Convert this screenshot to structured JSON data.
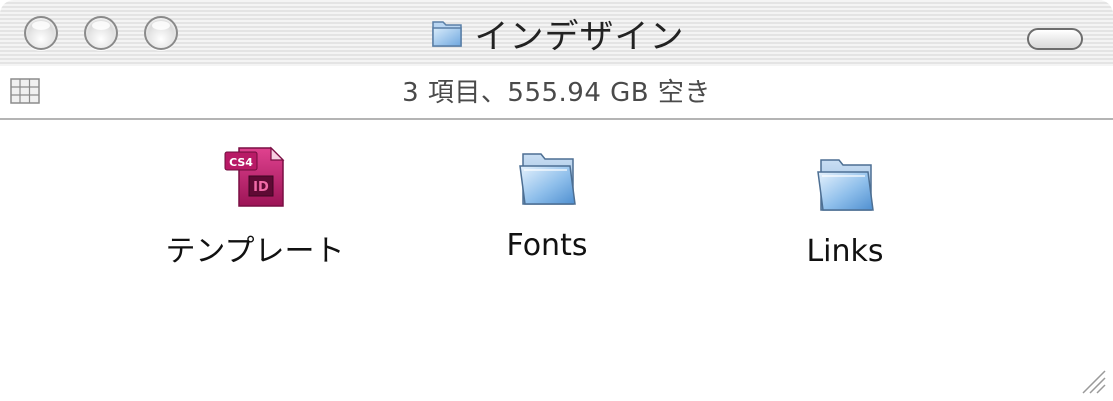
{
  "window": {
    "title": "インデザイン",
    "status_text": "3 項目、555.94 GB 空き"
  },
  "items": [
    {
      "label": "テンプレート",
      "icon": "indesign-document-icon",
      "badge": "CS4",
      "mark": "ID"
    },
    {
      "label": "Fonts",
      "icon": "folder-icon"
    },
    {
      "label": "Links",
      "icon": "folder-icon"
    }
  ],
  "colors": {
    "indesign_magenta": "#c2206e",
    "folder_blue": "#7fb2e6"
  }
}
